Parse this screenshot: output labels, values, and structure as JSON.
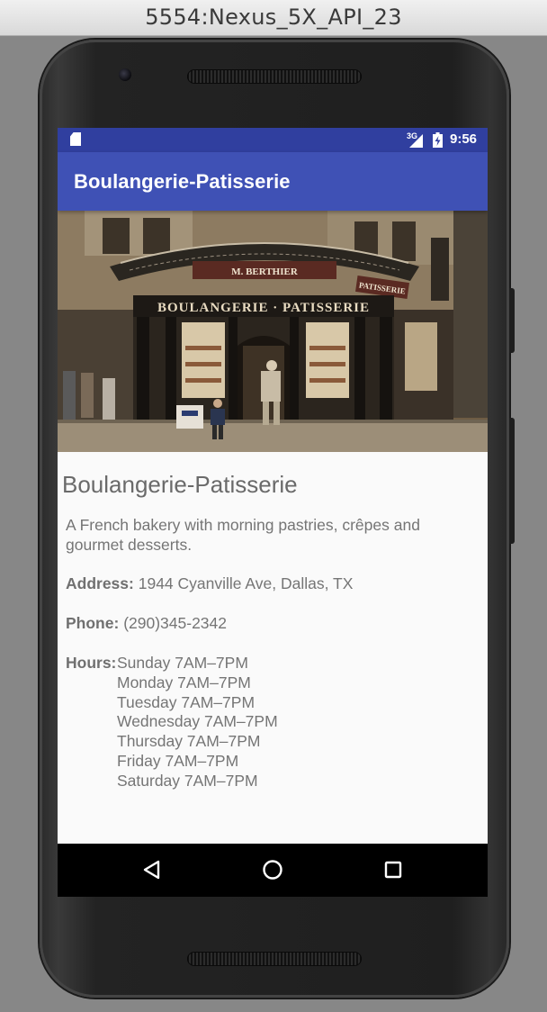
{
  "window": {
    "title": "5554:Nexus_5X_API_23"
  },
  "status_bar": {
    "network": "3G",
    "time": "9:56",
    "color": "#303f9f"
  },
  "app_bar": {
    "title": "Boulangerie-Patisserie",
    "color": "#3f51b5"
  },
  "hero_image": {
    "sign_text": "BOULANGERIE · PATISSERIE",
    "awning_text": "M. BERTHIER",
    "side_sign_text": "PATISSERIE"
  },
  "bakery": {
    "name": "Boulangerie-Patisserie",
    "description": "A French bakery with morning pastries, crêpes and gourmet desserts.",
    "address_label": "Address:",
    "address": "1944 Cyanville Ave, Dallas, TX",
    "phone_label": "Phone:",
    "phone": "(290)345-2342",
    "hours_label": "Hours:",
    "hours": [
      "Sunday 7AM–7PM",
      "Monday 7AM–7PM",
      "Tuesday 7AM–7PM",
      "Wednesday 7AM–7PM",
      "Thursday 7AM–7PM",
      "Friday 7AM–7PM",
      "Saturday 7AM–7PM"
    ]
  },
  "nav_bar": {
    "icons": [
      "back-icon",
      "home-icon",
      "recents-icon"
    ]
  }
}
